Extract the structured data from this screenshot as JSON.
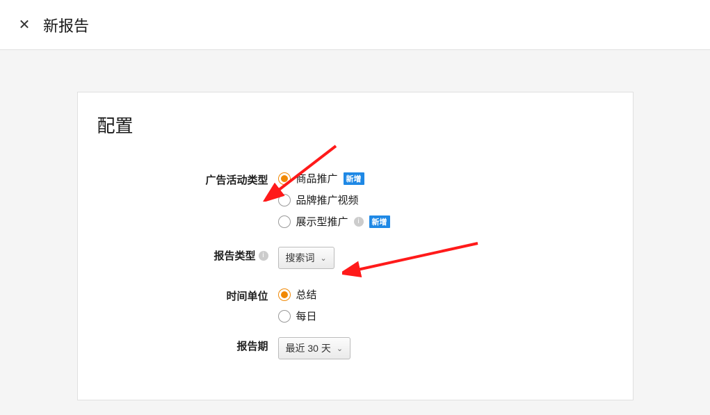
{
  "header": {
    "title": "新报告"
  },
  "card": {
    "title": "配置"
  },
  "form": {
    "campaign_type": {
      "label": "广告活动类型",
      "options": [
        {
          "label": "商品推广",
          "checked": true,
          "badge": "新增"
        },
        {
          "label": "品牌推广视频",
          "checked": false
        },
        {
          "label": "展示型推广",
          "checked": false,
          "info": true,
          "badge": "新增"
        }
      ]
    },
    "report_type": {
      "label": "报告类型",
      "selected": "搜索词"
    },
    "time_unit": {
      "label": "时间单位",
      "options": [
        {
          "label": "总结",
          "checked": true
        },
        {
          "label": "每日",
          "checked": false
        }
      ]
    },
    "report_period": {
      "label": "报告期",
      "selected": "最近 30 天"
    }
  }
}
